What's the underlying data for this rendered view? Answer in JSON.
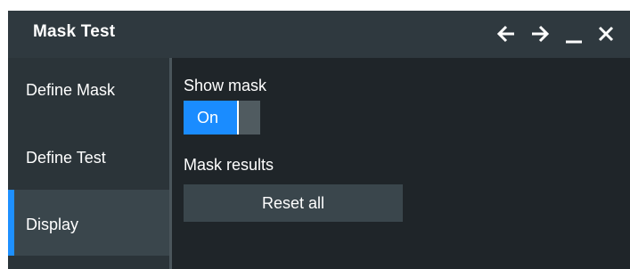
{
  "window": {
    "title": "Mask Test",
    "controls": [
      "arrow-left-icon",
      "arrow-right-icon",
      "minimize-icon",
      "close-icon"
    ]
  },
  "sidebar": {
    "items": [
      {
        "label": "Define Mask",
        "active": false
      },
      {
        "label": "Define Test",
        "active": false
      },
      {
        "label": "Display",
        "active": true
      }
    ]
  },
  "display": {
    "show_mask_label": "Show mask",
    "show_mask_toggle": {
      "value": "On",
      "state": true
    },
    "mask_results_label": "Mask results",
    "reset_all_label": "Reset all"
  },
  "colors": {
    "accent": "#1a8cff",
    "background": "#1f2529",
    "titlebar": "#2f393f",
    "sidebar": "#2b3439",
    "active_item": "#3a464c"
  }
}
